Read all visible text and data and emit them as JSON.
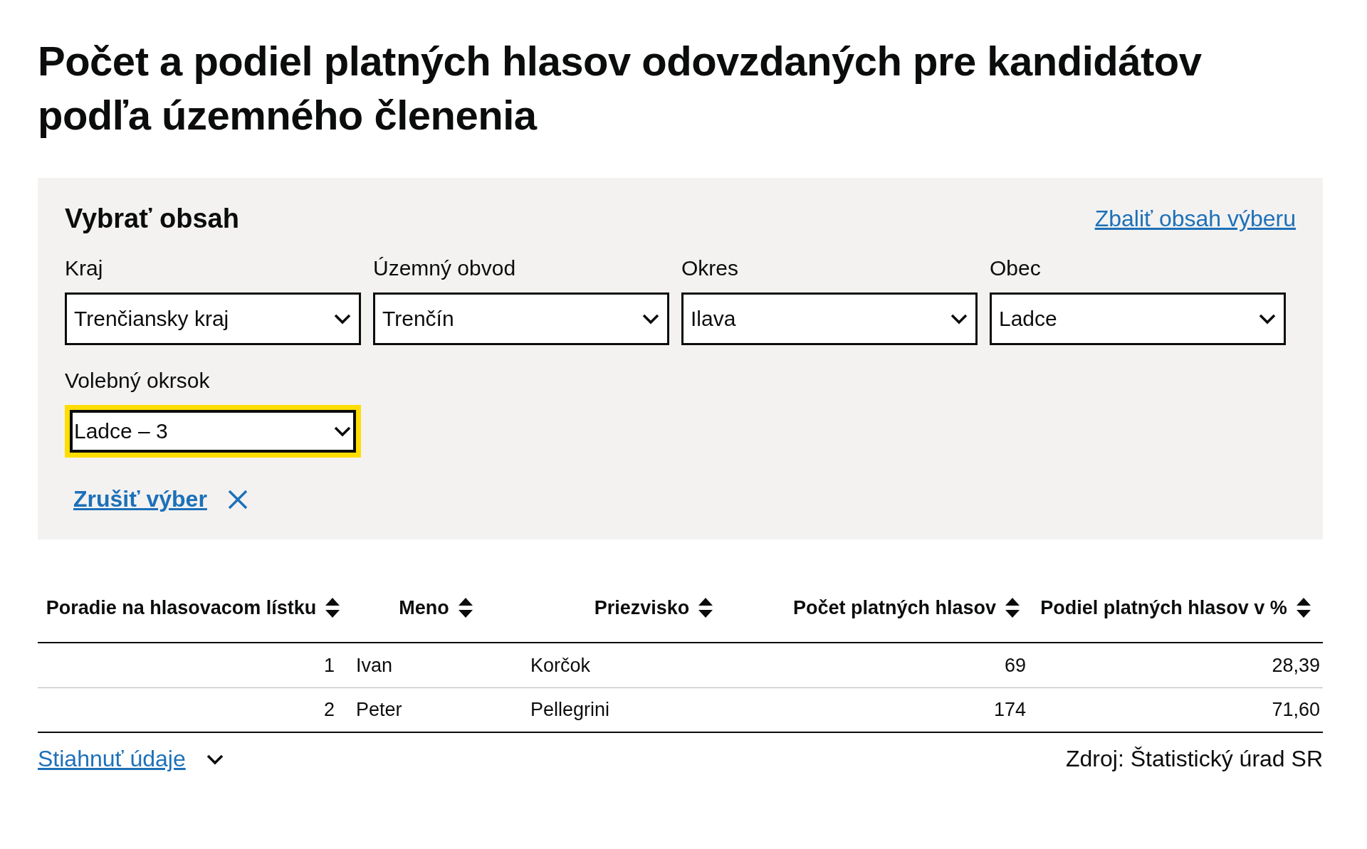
{
  "title": "Počet a podiel platných hlasov odovzdaných pre kandidátov podľa územného členenia",
  "filter_panel": {
    "heading": "Vybrať obsah",
    "collapse_link": "Zbaliť obsah výberu",
    "selects": [
      {
        "label": "Kraj",
        "value": "Trenčiansky kraj",
        "focused": false
      },
      {
        "label": "Územný obvod",
        "value": "Trenčín",
        "focused": false
      },
      {
        "label": "Okres",
        "value": "Ilava",
        "focused": false
      },
      {
        "label": "Obec",
        "value": "Ladce",
        "focused": false
      },
      {
        "label": "Volebný okrsok",
        "value": "Ladce – 3",
        "focused": true
      }
    ],
    "clear_link": "Zrušiť výber"
  },
  "table": {
    "columns": [
      "Poradie na hlasovacom lístku",
      "Meno",
      "Priezvisko",
      "Počet platných hlasov",
      "Podiel platných hlasov v %"
    ],
    "rows": [
      [
        "1",
        "Ivan",
        "Korčok",
        "69",
        "28,39"
      ],
      [
        "2",
        "Peter",
        "Pellegrini",
        "174",
        "71,60"
      ]
    ]
  },
  "footer": {
    "download_link": "Stiahnuť údaje",
    "source": "Zdroj: Štatistický úrad SR"
  }
}
